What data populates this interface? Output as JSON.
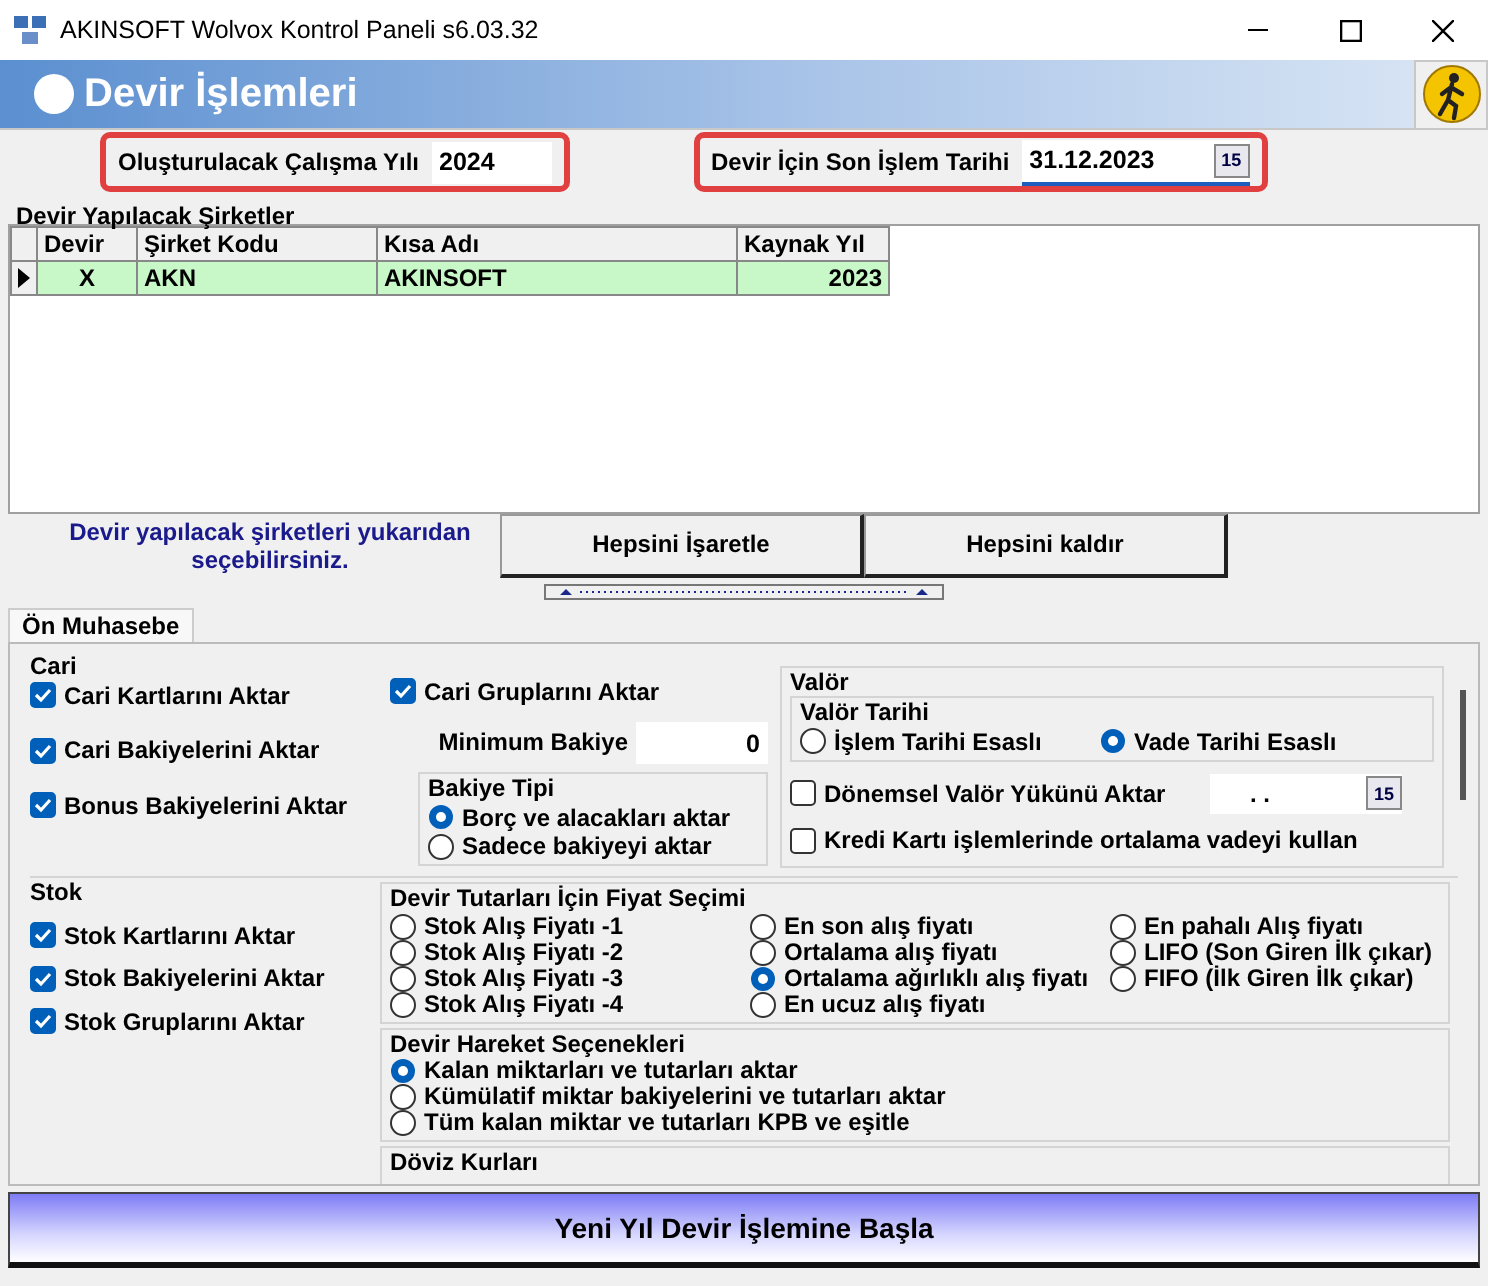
{
  "window": {
    "title": "AKINSOFT Wolvox Kontrol Paneli s6.03.32"
  },
  "header": {
    "title": "Devir İşlemleri"
  },
  "fields": [
    {
      "label": "Oluşturulacak Çalışma Yılı",
      "value": "2024"
    },
    {
      "label": "Devir İçin Son İşlem Tarihi",
      "value": "31.12.2023",
      "calendar": "15"
    }
  ],
  "companies": {
    "title": "Devir Yapılacak Şirketler",
    "columns": [
      "Devir",
      "Şirket Kodu",
      "Kısa Adı",
      "Kaynak Yıl"
    ],
    "rows": [
      {
        "cells": [
          "X",
          "AKN",
          "AKINSOFT",
          "2023"
        ],
        "selected": true
      }
    ]
  },
  "hint": "Devir yapılacak şirketleri yukarıdan seçebilirsiniz.",
  "buttons": [
    "Hepsini İşaretle",
    "Hepsini kaldır"
  ],
  "tabs": [
    {
      "label": "Ön Muhasebe",
      "selected": true
    }
  ],
  "cari": {
    "title": "Cari",
    "checks": [
      {
        "label": "Cari Kartlarını Aktar",
        "checked": true
      },
      {
        "label": "Cari Bakiyelerini Aktar",
        "checked": true
      },
      {
        "label": "Bonus Bakiyelerini Aktar",
        "checked": true
      }
    ],
    "group_check": {
      "label": "Cari Gruplarını Aktar",
      "checked": true
    },
    "min_balance": {
      "label": "Minimum Bakiye",
      "value": "0"
    },
    "balance_type": {
      "title": "Bakiye Tipi",
      "options": [
        {
          "label": "Borç ve alacakları aktar",
          "selected": true
        },
        {
          "label": "Sadece bakiyeyi aktar",
          "selected": false
        }
      ]
    },
    "valor": {
      "title": "Valör",
      "date": {
        "title": "Valör Tarihi",
        "options": [
          {
            "label": "İşlem Tarihi Esaslı",
            "selected": false
          },
          {
            "label": "Vade Tarihi Esaslı",
            "selected": true
          }
        ]
      },
      "periodic": {
        "label": "Dönemsel Valör Yükünü Aktar",
        "checked": false,
        "date_value": ". .",
        "calendar": "15"
      },
      "credit": {
        "label": "Kredi Kartı işlemlerinde ortalama vadeyi kullan",
        "checked": false
      }
    }
  },
  "stok": {
    "title": "Stok",
    "checks": [
      {
        "label": "Stok Kartlarını Aktar",
        "checked": true
      },
      {
        "label": "Stok Bakiyelerini Aktar",
        "checked": true
      },
      {
        "label": "Stok Gruplarını Aktar",
        "checked": true
      }
    ],
    "price": {
      "title": "Devir Tutarları İçin Fiyat Seçimi",
      "options": [
        {
          "label": "Stok Alış Fiyatı -1",
          "selected": false
        },
        {
          "label": "Stok Alış Fiyatı -2",
          "selected": false
        },
        {
          "label": "Stok Alış Fiyatı -3",
          "selected": false
        },
        {
          "label": "Stok Alış Fiyatı -4",
          "selected": false
        },
        {
          "label": "En son alış fiyatı",
          "selected": false
        },
        {
          "label": "Ortalama alış fiyatı",
          "selected": false
        },
        {
          "label": "Ortalama ağırlıklı alış fiyatı",
          "selected": true
        },
        {
          "label": "En ucuz alış fiyatı",
          "selected": false
        },
        {
          "label": "En pahalı Alış fiyatı",
          "selected": false
        },
        {
          "label": "LIFO (Son Giren İlk çıkar)",
          "selected": false
        },
        {
          "label": "FIFO (İlk Giren İlk çıkar)",
          "selected": false
        }
      ]
    },
    "movement": {
      "title": "Devir Hareket Seçenekleri",
      "options": [
        {
          "label": "Kalan miktarları ve tutarları aktar",
          "selected": true
        },
        {
          "label": "Kümülatif miktar bakiyelerini ve tutarları aktar",
          "selected": false
        },
        {
          "label": "Tüm kalan miktar ve tutarları KPB ve eşitle",
          "selected": false
        }
      ]
    },
    "currency": {
      "title": "Döviz Kurları"
    }
  },
  "start_button": "Yeni Yıl Devir İşlemine Başla"
}
